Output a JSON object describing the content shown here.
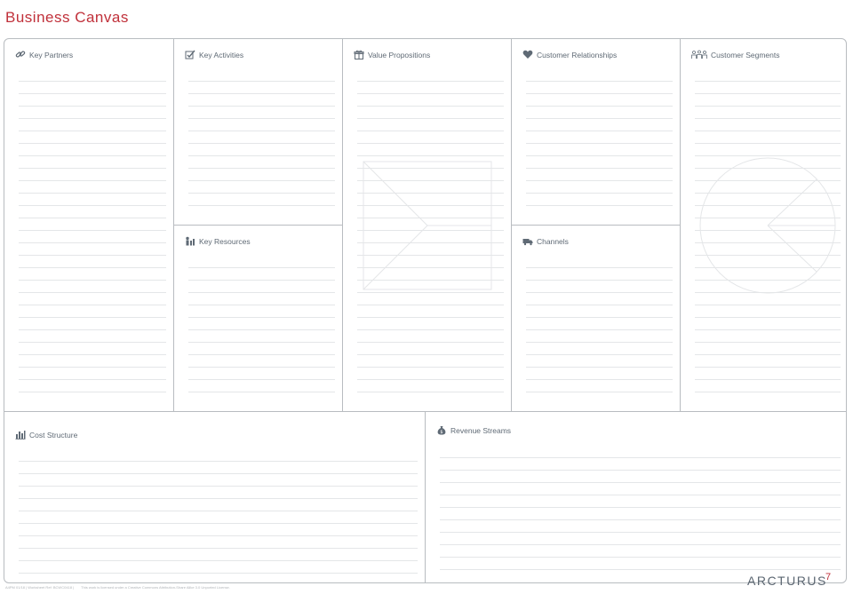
{
  "title": "Business Canvas",
  "sections": {
    "key_partners": "Key Partners",
    "key_activities": "Key Activities",
    "key_resources": "Key Resources",
    "value_propositions": "Value Propositions",
    "customer_relationships": "Customer Relationships",
    "channels": "Channels",
    "customer_segments": "Customer Segments",
    "cost_structure": "Cost Structure",
    "revenue_streams": "Revenue Streams"
  },
  "footer": {
    "ref": "A4PM 01/18 | Worksheet Ref: BCWC0418 |",
    "license": "This work is licensed under a Creative Commons Attribution-Share Alike 3.0 Unported License."
  },
  "brand": {
    "name": "ARCTURUS",
    "number": "7"
  },
  "icons": {
    "key_partners": "link-icon",
    "key_activities": "checkbox-icon",
    "key_resources": "resources-icon",
    "value_propositions": "gift-icon",
    "customer_relationships": "heart-icon",
    "channels": "truck-icon",
    "customer_segments": "people-icon",
    "cost_structure": "bar-chart-icon",
    "revenue_streams": "money-bag-icon"
  },
  "colors": {
    "title": "#c0303a",
    "text": "#5a6570",
    "border": "#b8bcc0"
  }
}
